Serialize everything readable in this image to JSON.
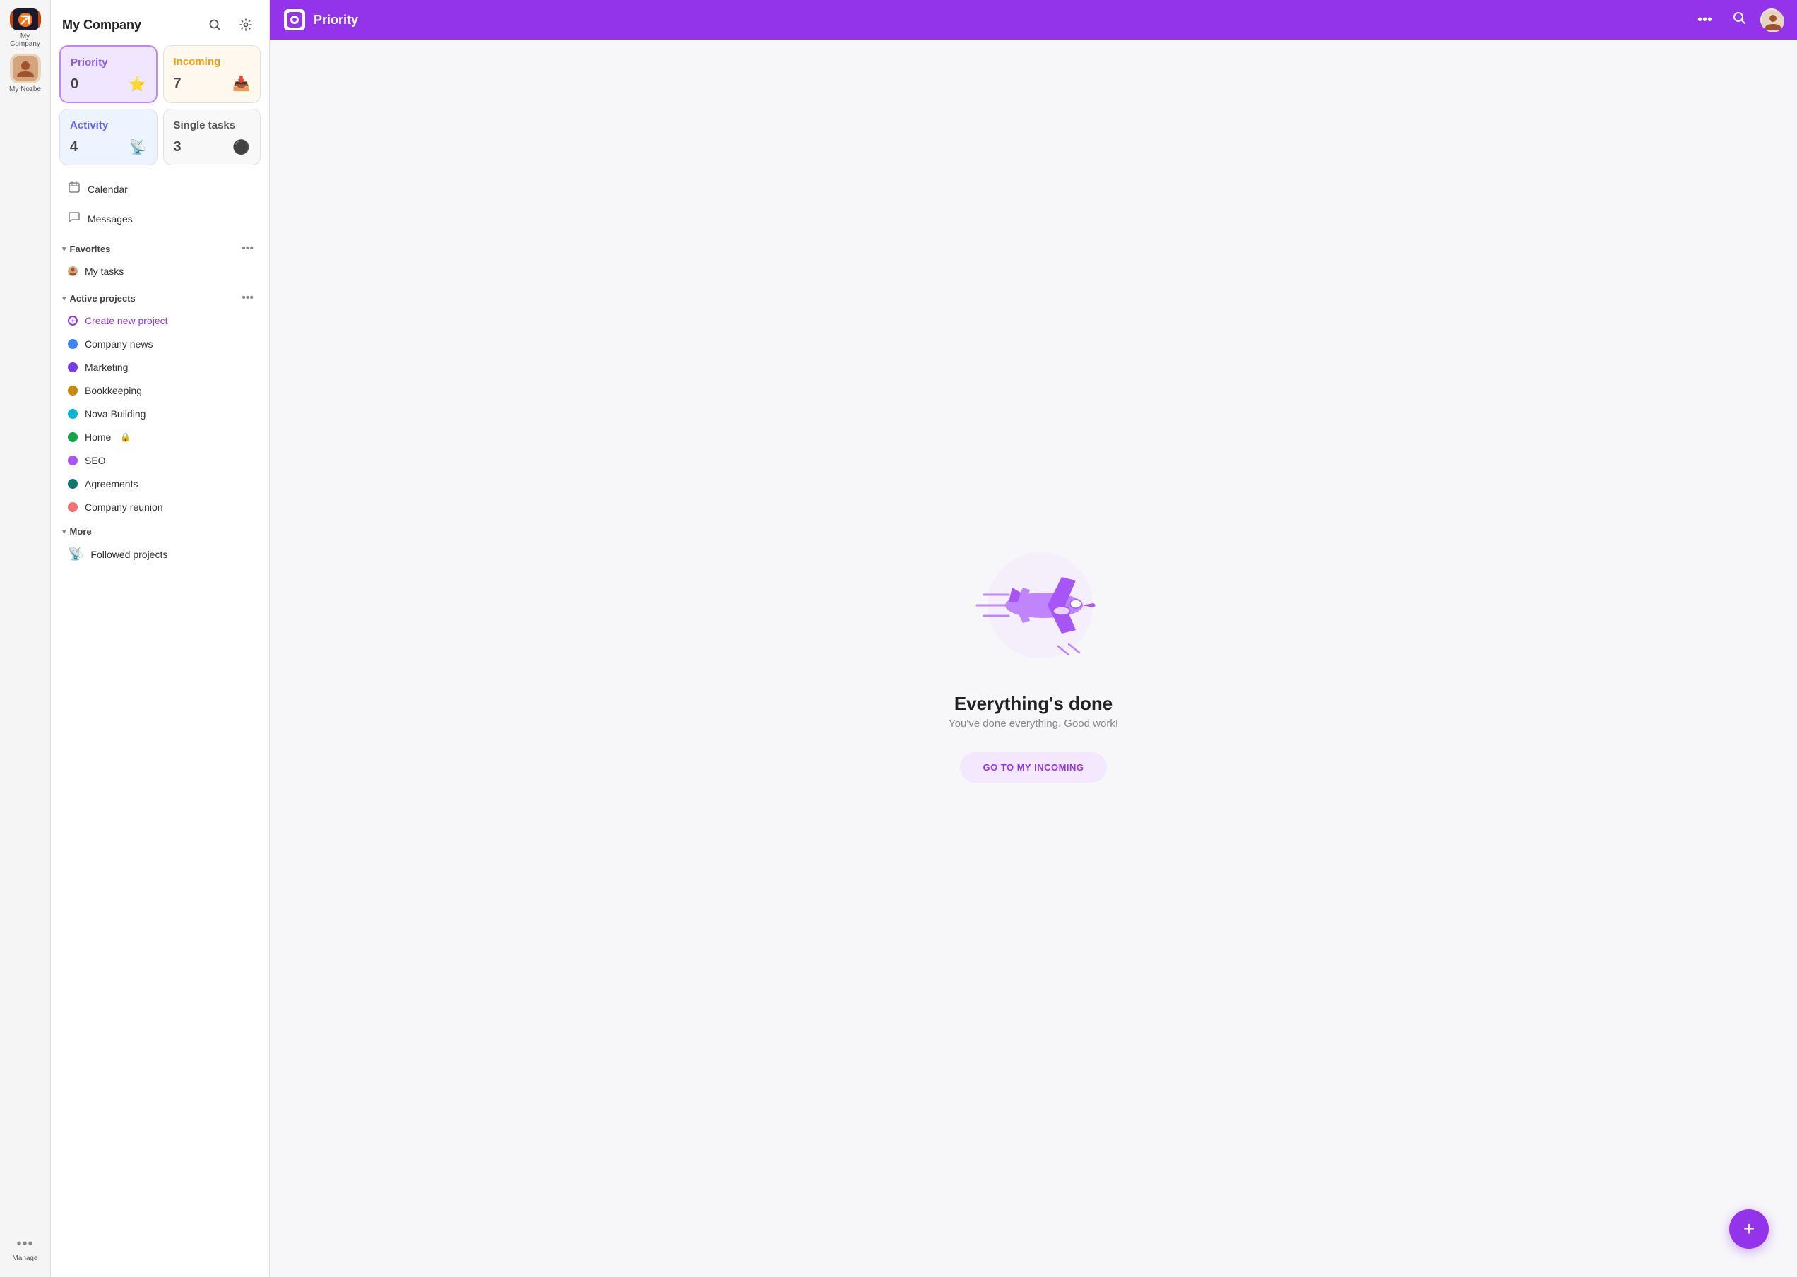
{
  "app": {
    "company_name": "My Company",
    "my_nozbe_label": "My Nozbe",
    "manage_label": "Manage"
  },
  "sidebar": {
    "search_icon": "🔍",
    "settings_icon": "⚙️",
    "cards": [
      {
        "id": "priority",
        "label": "Priority",
        "count": "0",
        "icon": "⭐",
        "type": "priority"
      },
      {
        "id": "incoming",
        "label": "Incoming",
        "count": "7",
        "icon": "📥",
        "type": "incoming"
      },
      {
        "id": "activity",
        "label": "Activity",
        "count": "4",
        "icon": "📡",
        "type": "activity"
      },
      {
        "id": "single-tasks",
        "label": "Single tasks",
        "count": "3",
        "icon": "⚫",
        "type": "single"
      }
    ],
    "nav_items": [
      {
        "id": "calendar",
        "label": "Calendar",
        "icon": "📅"
      },
      {
        "id": "messages",
        "label": "Messages",
        "icon": "💬"
      }
    ],
    "favorites": {
      "label": "Favorites",
      "more_icon": "•••",
      "items": [
        {
          "id": "my-tasks",
          "label": "My tasks",
          "avatar": true
        }
      ]
    },
    "active_projects": {
      "label": "Active projects",
      "more_icon": "•••",
      "create_label": "Create new project",
      "items": [
        {
          "id": "company-news",
          "label": "Company news",
          "color": "#3b82f6"
        },
        {
          "id": "marketing",
          "label": "Marketing",
          "color": "#7c3aed"
        },
        {
          "id": "bookkeeping",
          "label": "Bookkeeping",
          "color": "#ca8a04"
        },
        {
          "id": "nova-building",
          "label": "Nova Building",
          "color": "#06b6d4"
        },
        {
          "id": "home",
          "label": "Home",
          "color": "#16a34a",
          "lock": true
        },
        {
          "id": "seo",
          "label": "SEO",
          "color": "#a855f7"
        },
        {
          "id": "agreements",
          "label": "Agreements",
          "color": "#0f766e"
        },
        {
          "id": "company-reunion",
          "label": "Company reunion",
          "color": "#f87171"
        }
      ]
    },
    "more": {
      "label": "More",
      "items": [
        {
          "id": "followed-projects",
          "label": "Followed projects",
          "icon": "📡"
        }
      ]
    }
  },
  "topbar": {
    "title": "Priority",
    "more_icon": "•••",
    "search_icon": "🔍"
  },
  "main_content": {
    "illustration_alt": "airplane",
    "heading": "Everything's done",
    "subheading": "You've done everything. Good work!",
    "cta_button": "GO TO MY INCOMING"
  },
  "fab": {
    "icon": "+",
    "label": "create-button"
  }
}
